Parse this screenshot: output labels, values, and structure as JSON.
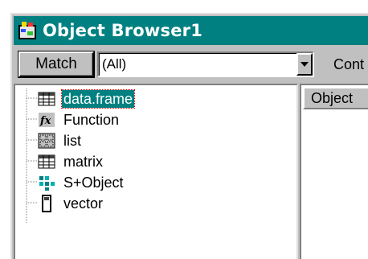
{
  "window": {
    "title": "Object Browser1",
    "title_bar_color": "#008080"
  },
  "toolbar": {
    "match_label": "Match",
    "filter_value": "(All)",
    "cont_label": "Cont"
  },
  "tree": {
    "items": [
      {
        "label": "data.frame",
        "icon": "grid-icon",
        "selected": true
      },
      {
        "label": "Function",
        "icon": "function-icon",
        "selected": false
      },
      {
        "label": "list",
        "icon": "list-icon",
        "selected": false
      },
      {
        "label": "matrix",
        "icon": "grid-icon",
        "selected": false
      },
      {
        "label": "S+Object",
        "icon": "object-icon",
        "selected": false
      },
      {
        "label": "vector",
        "icon": "vector-icon",
        "selected": false
      }
    ]
  },
  "list_pane": {
    "column_header": "Object"
  },
  "colors": {
    "selection": "#008080",
    "window_bg": "#c0c0c0"
  }
}
